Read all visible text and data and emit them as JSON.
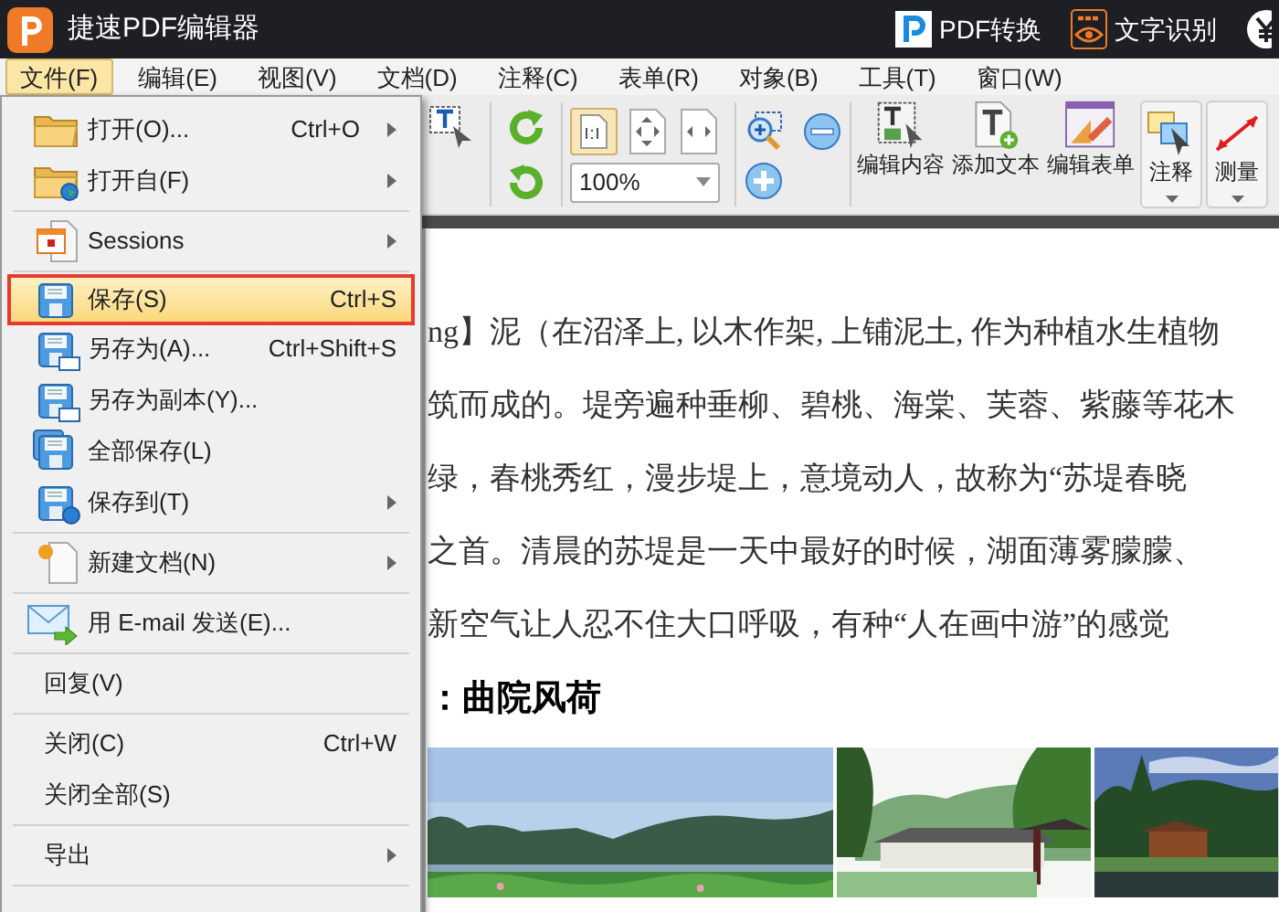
{
  "window": {
    "title": "捷速PDF编辑器"
  },
  "header_links": [
    {
      "label": "PDF转换"
    },
    {
      "label": "文字识别"
    }
  ],
  "menu_bar": [
    {
      "label": "文件(F)",
      "selected": true
    },
    {
      "label": "编辑(E)",
      "selected": false
    },
    {
      "label": "视图(V)",
      "selected": false
    },
    {
      "label": "文档(D)",
      "selected": false
    },
    {
      "label": "注释(C)",
      "selected": false
    },
    {
      "label": "表单(R)",
      "selected": false
    },
    {
      "label": "对象(B)",
      "selected": false
    },
    {
      "label": "工具(T)",
      "selected": false
    },
    {
      "label": "窗口(W)",
      "selected": false
    }
  ],
  "toolbar": {
    "zoom_value": "100%",
    "buttons": [
      {
        "label": "编辑内容",
        "kind": "plain"
      },
      {
        "label": "添加文本",
        "kind": "plain"
      },
      {
        "label": "编辑表单",
        "kind": "plain"
      },
      {
        "label": "注释",
        "kind": "dropdown"
      },
      {
        "label": "测量",
        "kind": "dropdown"
      }
    ]
  },
  "file_menu": [
    {
      "kind": "item",
      "label": "打开(O)...",
      "shortcut": "Ctrl+O",
      "submenu": true,
      "selected": false
    },
    {
      "kind": "item",
      "label": "打开自(F)",
      "submenu": true,
      "selected": false
    },
    {
      "kind": "separator"
    },
    {
      "kind": "item",
      "label": "Sessions",
      "submenu": true,
      "selected": false
    },
    {
      "kind": "separator"
    },
    {
      "kind": "item",
      "label": "保存(S)",
      "shortcut": "Ctrl+S",
      "submenu": false,
      "selected": true
    },
    {
      "kind": "item",
      "label": "另存为(A)...",
      "shortcut": "Ctrl+Shift+S",
      "submenu": false,
      "selected": false
    },
    {
      "kind": "item",
      "label": "另存为副本(Y)...",
      "submenu": false,
      "selected": false
    },
    {
      "kind": "item",
      "label": "全部保存(L)",
      "submenu": false,
      "selected": false
    },
    {
      "kind": "item",
      "label": "保存到(T)",
      "submenu": true,
      "selected": false
    },
    {
      "kind": "separator"
    },
    {
      "kind": "item",
      "label": "新建文档(N)",
      "submenu": true,
      "selected": false
    },
    {
      "kind": "separator"
    },
    {
      "kind": "item",
      "label": "用 E-mail 发送(E)...",
      "submenu": false,
      "selected": false
    },
    {
      "kind": "separator"
    },
    {
      "kind": "item",
      "label": "回复(V)",
      "submenu": false,
      "selected": false
    },
    {
      "kind": "separator"
    },
    {
      "kind": "item",
      "label": "关闭(C)",
      "shortcut": "Ctrl+W",
      "submenu": false,
      "selected": false
    },
    {
      "kind": "item",
      "label": "关闭全部(S)",
      "submenu": false,
      "selected": false
    },
    {
      "kind": "separator"
    },
    {
      "kind": "item",
      "label": "导出",
      "submenu": true,
      "selected": false
    },
    {
      "kind": "separator"
    }
  ],
  "document": {
    "lines": [
      "ng】泥（在沼泽上, 以木作架, 上铺泥土, 作为种植水生植物",
      "筑而成的。堤旁遍种垂柳、碧桃、海棠、芙蓉、紫藤等花木",
      "绿，春桃秀红，漫步堤上，意境动人，故称为“苏堤春晓",
      "之首。清晨的苏堤是一天中最好的时候，湖面薄雾朦朦、",
      "新空气让人忍不住大口呼吸，有种“人在画中游”的感觉"
    ],
    "heading": "：曲院风荷"
  }
}
